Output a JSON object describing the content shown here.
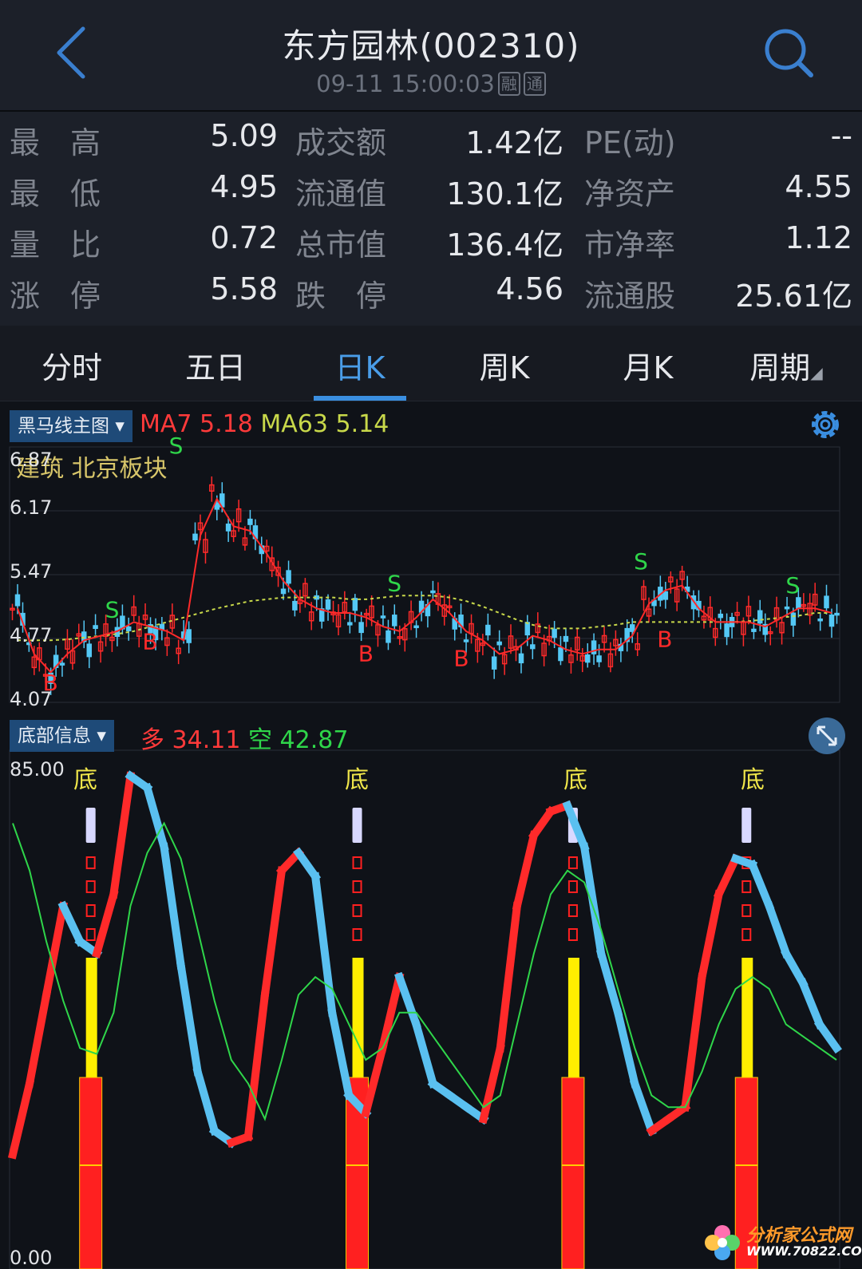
{
  "header": {
    "title": "东方园林(002310)",
    "datetime": "09-11 15:00:03",
    "badge_margin": "融",
    "badge_connect": "通"
  },
  "stats": [
    {
      "label": "最　高",
      "value": "5.09",
      "label2": "成交额",
      "value2": "1.42亿",
      "label3": "PE(动)",
      "value3": "--"
    },
    {
      "label": "最　低",
      "value": "4.95",
      "label2": "流通值",
      "value2": "130.1亿",
      "label3": "净资产",
      "value3": "4.55"
    },
    {
      "label": "量　比",
      "value": "0.72",
      "label2": "总市值",
      "value2": "136.4亿",
      "label3": "市净率",
      "value3": "1.12"
    },
    {
      "label": "涨　停",
      "value": "5.58",
      "label2": "跌　停",
      "value2": "4.56",
      "label3": "流通股",
      "value3": "25.61亿"
    }
  ],
  "tabs": [
    "分时",
    "五日",
    "日K",
    "周K",
    "月K",
    "周期"
  ],
  "active_tab": "日K",
  "main_chart": {
    "selector": "黑马线主图",
    "ma7_label": "MA7",
    "ma7_value": "5.18",
    "ma63_label": "MA63",
    "ma63_value": "5.14",
    "sector_text": "建筑 北京板块",
    "y_ticks": [
      "6.87",
      "6.17",
      "5.47",
      "4.77",
      "4.07"
    ],
    "signals": [
      {
        "text": "B",
        "x": 0.04,
        "price": 4.2
      },
      {
        "text": "S",
        "x": 0.115,
        "price": 5.0
      },
      {
        "text": "B",
        "x": 0.16,
        "price": 4.65
      },
      {
        "text": "S",
        "x": 0.192,
        "price": 6.8
      },
      {
        "text": "S",
        "x": 0.455,
        "price": 5.29
      },
      {
        "text": "B",
        "x": 0.42,
        "price": 4.52
      },
      {
        "text": "B",
        "x": 0.535,
        "price": 4.47
      },
      {
        "text": "S",
        "x": 0.752,
        "price": 5.53
      },
      {
        "text": "B",
        "x": 0.78,
        "price": 4.68
      },
      {
        "text": "S",
        "x": 0.935,
        "price": 5.27
      }
    ],
    "colors": {
      "up": "#ff2a2a",
      "down": "#54c8f5",
      "ma7": "#ff2a2a",
      "ma63": "#c8d84a",
      "signal_s": "#2fd64a",
      "signal_b": "#ff2a2a"
    }
  },
  "sub_chart": {
    "selector": "底部信息",
    "duo_label": "多",
    "duo_value": "34.11",
    "kong_label": "空",
    "kong_value": "42.87",
    "y_top": "85.00",
    "y_bottom": "0.00",
    "bottom_label": "底",
    "bottom_positions": [
      0.092,
      0.413,
      0.673,
      0.882
    ],
    "colors": {
      "duo": "#ff2a2a",
      "kong": "#5ac0f0",
      "signal": "#2fd64a",
      "bar_yellow": "#ffee00",
      "bar_red": "#ff2020",
      "marker": "#d8d8ff"
    }
  },
  "chart_data": {
    "type": "line",
    "title": "",
    "series": [
      {
        "name": "MA7",
        "values": [
          5.1,
          4.6,
          4.4,
          4.6,
          4.75,
          4.8,
          4.85,
          4.95,
          4.9,
          4.85,
          4.75,
          5.9,
          6.3,
          6.0,
          5.95,
          5.7,
          5.4,
          5.2,
          5.1,
          5.05,
          5.05,
          5.0,
          4.9,
          4.85,
          5.0,
          5.2,
          5.05,
          4.85,
          4.75,
          4.6,
          4.65,
          4.8,
          4.75,
          4.65,
          4.6,
          4.65,
          4.65,
          4.8,
          5.15,
          5.3,
          5.35,
          5.1,
          4.95,
          4.95,
          4.95,
          4.9,
          5.0,
          5.1,
          5.1,
          5.05
        ]
      },
      {
        "name": "MA63",
        "values": [
          4.75,
          4.75,
          4.75,
          4.76,
          4.78,
          4.8,
          4.82,
          4.85,
          4.9,
          4.95,
          5.0,
          5.05,
          5.1,
          5.14,
          5.18,
          5.2,
          5.22,
          5.22,
          5.22,
          5.22,
          5.2,
          5.2,
          5.22,
          5.24,
          5.24,
          5.24,
          5.22,
          5.18,
          5.12,
          5.05,
          4.98,
          4.92,
          4.88,
          4.88,
          4.88,
          4.9,
          4.92,
          4.95,
          4.95,
          4.95,
          4.95,
          4.95,
          4.95,
          4.95,
          4.96,
          4.98,
          5.0,
          5.02,
          5.05,
          5.05
        ]
      },
      {
        "name": "多",
        "values": [
          18,
          30,
          45,
          60,
          54,
          52,
          62,
          82,
          80,
          70,
          50,
          32,
          22,
          20,
          21,
          45,
          66,
          69,
          65,
          42,
          28,
          25,
          36,
          48,
          40,
          30,
          28,
          26,
          24,
          36,
          60,
          72,
          76,
          77,
          70,
          52,
          42,
          30,
          22,
          24,
          26,
          48,
          62,
          68,
          67,
          60,
          52,
          47,
          40,
          36
        ]
      },
      {
        "name": "空",
        "values": [
          74,
          66,
          54,
          44,
          36,
          35,
          42,
          60,
          69,
          74,
          68,
          56,
          44,
          34,
          30,
          24,
          34,
          45,
          48,
          46,
          40,
          34,
          36,
          42,
          42,
          38,
          34,
          30,
          26,
          28,
          40,
          52,
          62,
          66,
          64,
          56,
          46,
          36,
          28,
          26,
          26,
          32,
          40,
          46,
          48,
          46,
          40,
          38,
          36,
          34
        ]
      }
    ],
    "ylim": [
      4.07,
      6.87
    ],
    "sub_ylim": [
      0,
      85
    ]
  },
  "watermark": {
    "line1": "分析家公式网",
    "line2": "WWW.70822.COM"
  }
}
